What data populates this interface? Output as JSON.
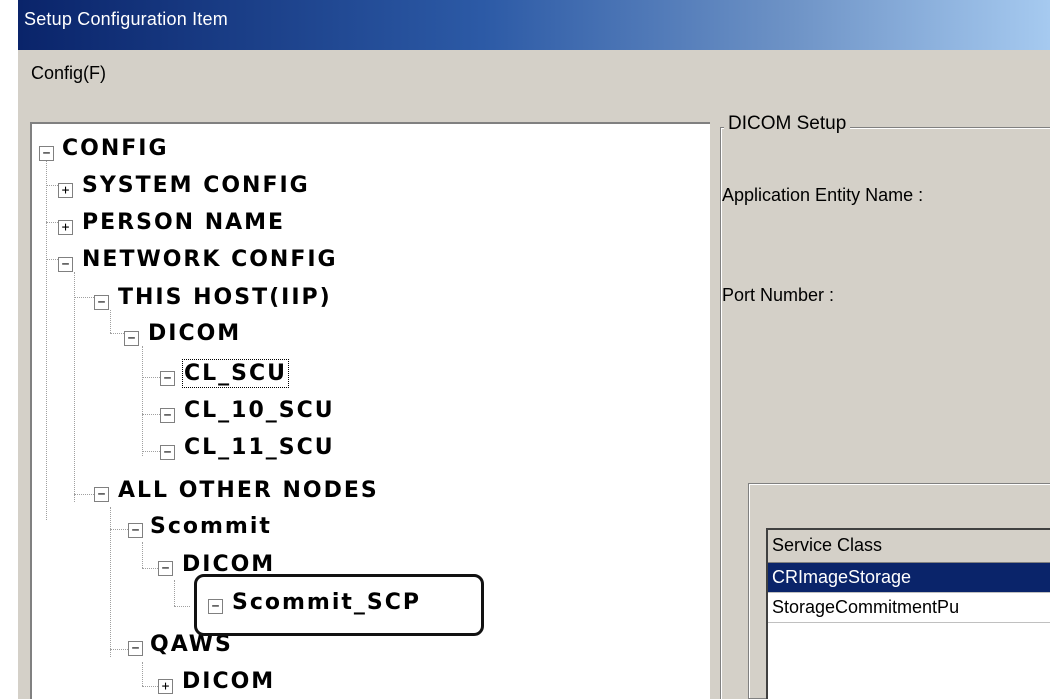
{
  "window": {
    "title": "Setup Configuration Item"
  },
  "menu": {
    "config": "Config(F)"
  },
  "tree": {
    "nodes": [
      {
        "label": "CONFIG",
        "expander": "−"
      },
      {
        "label": "SYSTEM CONFIG",
        "expander": "+"
      },
      {
        "label": "PERSON NAME",
        "expander": "+"
      },
      {
        "label": "NETWORK CONFIG",
        "expander": "−"
      },
      {
        "label": "THIS HOST(IIP)",
        "expander": "−"
      },
      {
        "label": "DICOM",
        "expander": "−"
      },
      {
        "label": "CL_SCU",
        "expander": "−"
      },
      {
        "label": "CL_10_SCU",
        "expander": "−"
      },
      {
        "label": "CL_11_SCU",
        "expander": "−"
      },
      {
        "label": "ALL OTHER NODES",
        "expander": "−"
      },
      {
        "label": "Scommit",
        "expander": "−"
      },
      {
        "label": "DICOM",
        "expander": "−"
      },
      {
        "label": "Scommit_SCP",
        "expander": "−"
      },
      {
        "label": "QAWS",
        "expander": "−"
      },
      {
        "label": "DICOM",
        "expander": "+"
      }
    ]
  },
  "dicom_setup": {
    "group_title": "DICOM Setup",
    "application_entity_label": "Application Entity Name :",
    "port_number_label": "Port Number :",
    "service_list": {
      "header": "Service Class",
      "rows": [
        "CRImageStorage",
        "StorageCommitmentPu"
      ],
      "selected_row": "CRImageStorage"
    }
  },
  "colors": {
    "title_bar_start": "#0a246a",
    "title_bar_end": "#a6caf0",
    "dialog_face": "#d4d0c8",
    "selection": "#0a246a"
  }
}
